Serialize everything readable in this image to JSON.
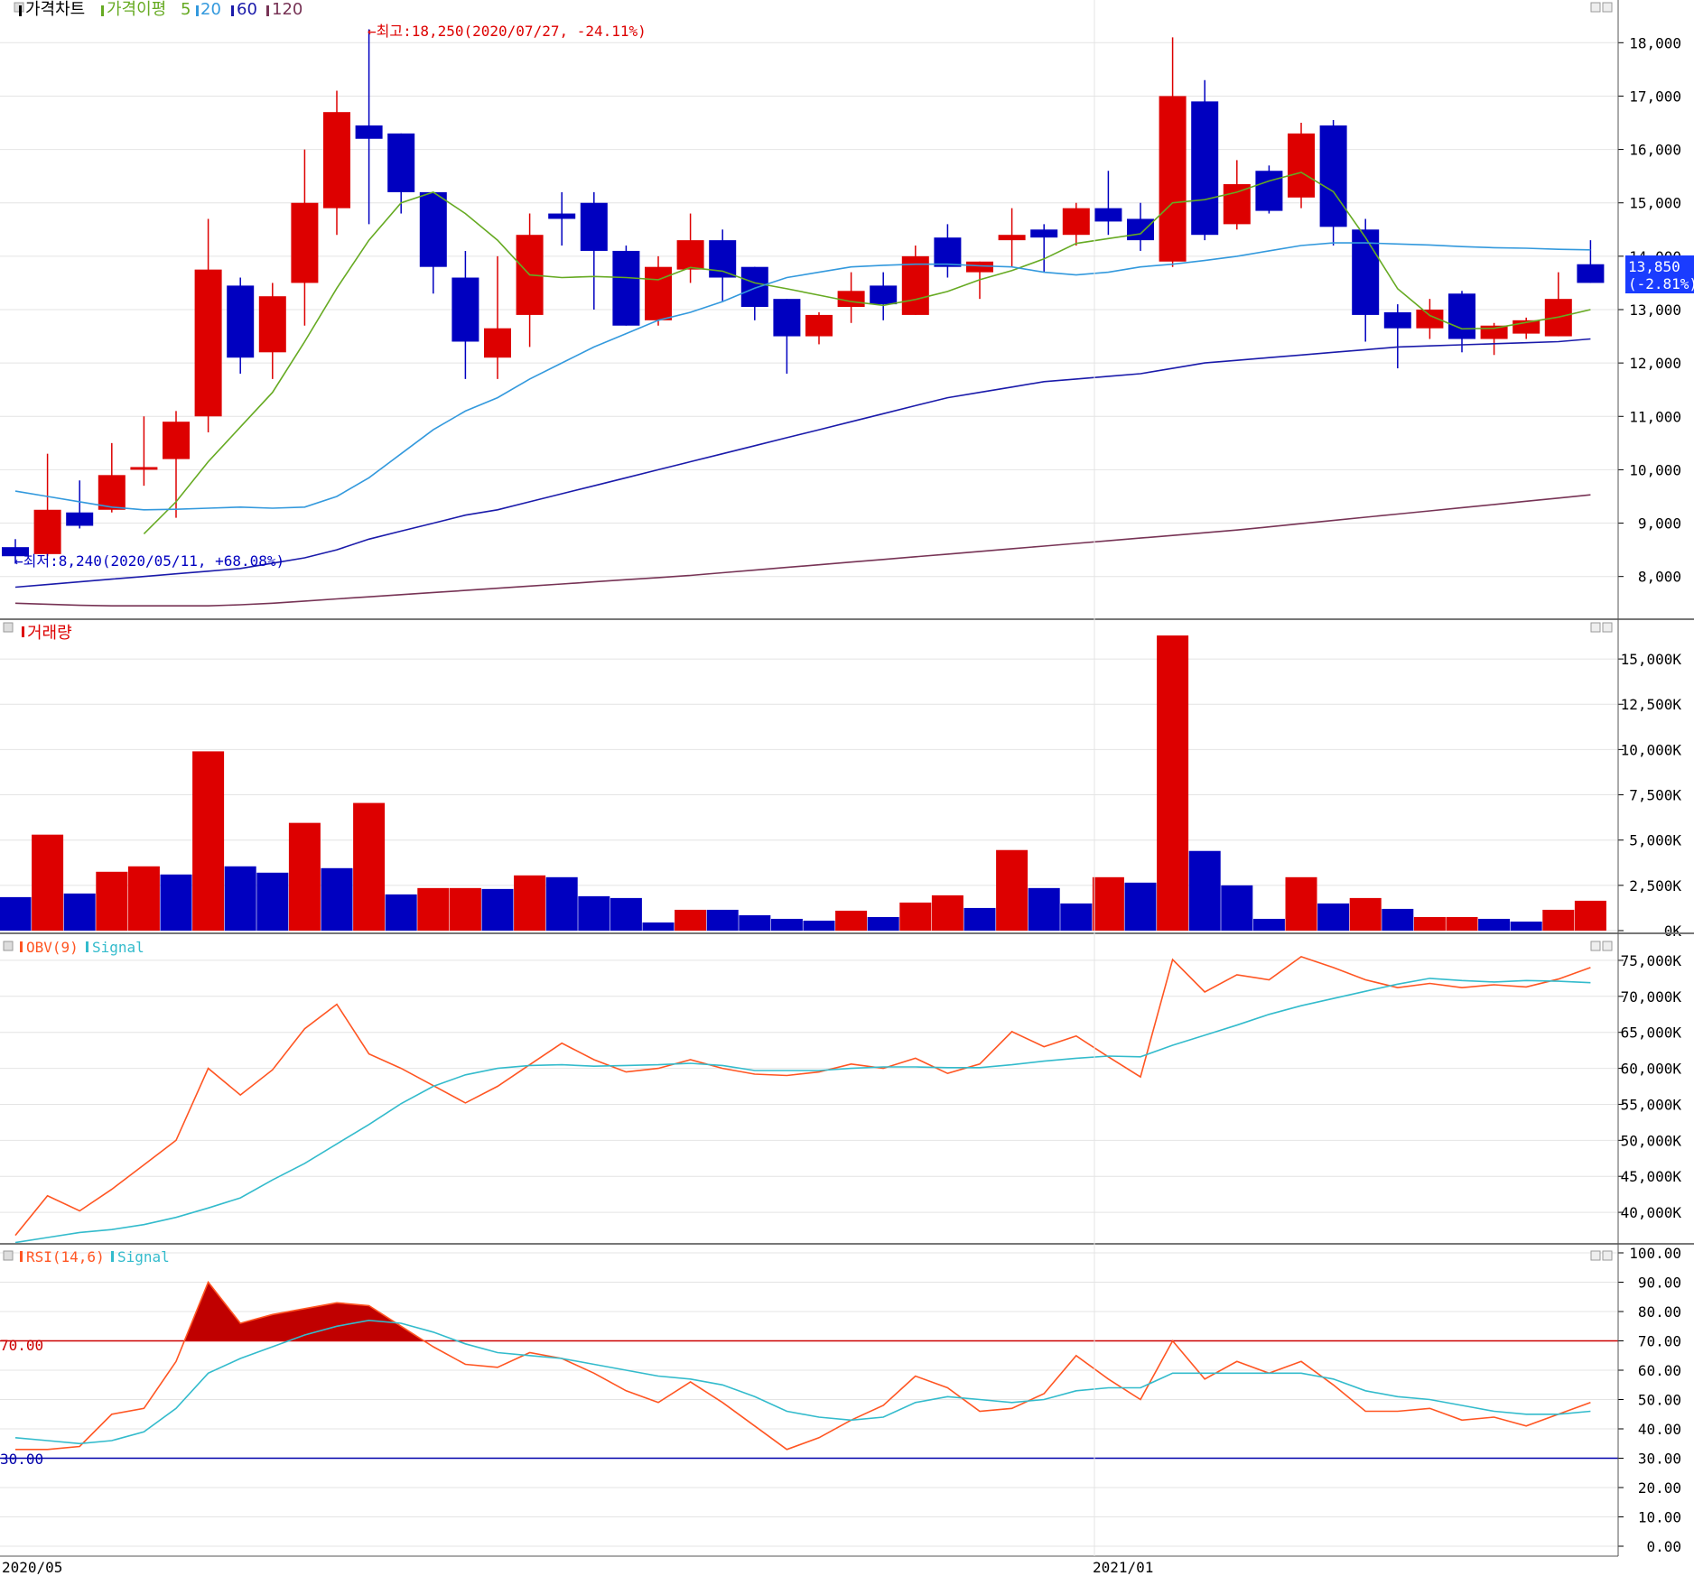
{
  "price_panel": {
    "legend_title": "가격차트",
    "legend_ma_label": "가격이평",
    "ma_periods": [
      "5",
      "20",
      "60",
      "120"
    ],
    "high_marker": "←최고:18,250(2020/07/27, -24.11%)",
    "low_marker": "←최저:8,240(2020/05/11, +68.08%)",
    "current_price": "13,850",
    "current_change": "(-2.81%)",
    "y_ticks": [
      "8,000",
      "9,000",
      "10,000",
      "11,000",
      "12,000",
      "13,000",
      "14,000",
      "15,000",
      "16,000",
      "17,000",
      "18,000"
    ]
  },
  "volume_panel": {
    "legend_title": "거래량",
    "y_ticks": [
      "0K",
      "2,500K",
      "5,000K",
      "7,500K",
      "10,000K",
      "12,500K",
      "15,000K"
    ]
  },
  "obv_panel": {
    "legend_title": "OBV(9)",
    "legend_signal": "Signal",
    "y_ticks": [
      "40,000K",
      "45,000K",
      "50,000K",
      "55,000K",
      "60,000K",
      "65,000K",
      "70,000K",
      "75,000K"
    ]
  },
  "rsi_panel": {
    "legend_title": "RSI(14,6)",
    "legend_signal": "Signal",
    "upper_line_label": "70.00",
    "lower_line_label": "30.00",
    "y_ticks": [
      "0.00",
      "10.00",
      "20.00",
      "30.00",
      "40.00",
      "50.00",
      "60.00",
      "70.00",
      "80.00",
      "90.00",
      "100.00"
    ]
  },
  "x_axis": {
    "labels": [
      "2020/05",
      "2021/01"
    ]
  },
  "colors": {
    "up": "#dd0000",
    "down": "#0000c0",
    "ma5": "#66aa22",
    "ma20": "#3399dd",
    "ma60": "#1a1aaa",
    "ma120": "#773355",
    "obv": "#ff5522",
    "signal": "#33bbcc",
    "rsi_fill": "#c00000",
    "upper": "#cc0000",
    "lower": "#0000aa"
  },
  "chart_data": [
    {
      "type": "candlestick",
      "title": "가격차트",
      "interval": "weekly",
      "x_start": "2020/05",
      "ylim": [
        7200,
        18800
      ],
      "candles": [
        [
          8550,
          8700,
          8240,
          8380
        ],
        [
          8420,
          10300,
          8380,
          9250
        ],
        [
          9200,
          9800,
          8900,
          8950
        ],
        [
          9250,
          10500,
          9200,
          9900
        ],
        [
          10000,
          11000,
          9700,
          10050
        ],
        [
          10200,
          11100,
          9100,
          10900
        ],
        [
          11000,
          14700,
          10700,
          13750
        ],
        [
          13450,
          13600,
          11800,
          12100
        ],
        [
          12200,
          13500,
          11700,
          13250
        ],
        [
          13500,
          16000,
          12700,
          15000
        ],
        [
          14900,
          17100,
          14400,
          16700
        ],
        [
          16450,
          18250,
          14600,
          16200
        ],
        [
          16300,
          16300,
          14800,
          15200
        ],
        [
          15200,
          15200,
          13300,
          13800
        ],
        [
          13600,
          14100,
          11700,
          12400
        ],
        [
          12100,
          14000,
          11700,
          12650
        ],
        [
          12900,
          14800,
          12300,
          14400
        ],
        [
          14800,
          15200,
          14200,
          14700
        ],
        [
          15000,
          15200,
          13000,
          14100
        ],
        [
          14100,
          14200,
          12700,
          12700
        ],
        [
          12800,
          14000,
          12700,
          13800
        ],
        [
          13750,
          14800,
          13500,
          14300
        ],
        [
          14300,
          14500,
          13150,
          13600
        ],
        [
          13800,
          13800,
          12800,
          13050
        ],
        [
          13200,
          13200,
          11800,
          12500
        ],
        [
          12500,
          12950,
          12350,
          12900
        ],
        [
          13050,
          13700,
          12750,
          13350
        ],
        [
          13450,
          13700,
          12800,
          13100
        ],
        [
          12900,
          14200,
          12900,
          14000
        ],
        [
          14350,
          14600,
          13600,
          13800
        ],
        [
          13700,
          13900,
          13200,
          13900
        ],
        [
          14300,
          14900,
          13800,
          14400
        ],
        [
          14500,
          14600,
          13700,
          14350
        ],
        [
          14400,
          15000,
          14200,
          14900
        ],
        [
          14900,
          15600,
          14400,
          14650
        ],
        [
          14700,
          15000,
          14100,
          14300
        ],
        [
          13900,
          18100,
          13800,
          17000
        ],
        [
          16900,
          17300,
          14300,
          14400
        ],
        [
          14600,
          15800,
          14500,
          15350
        ],
        [
          15600,
          15700,
          14800,
          14850
        ],
        [
          15100,
          16500,
          14900,
          16300
        ],
        [
          16450,
          16550,
          14200,
          14550
        ],
        [
          14500,
          14700,
          12400,
          12900
        ],
        [
          12950,
          13100,
          11900,
          12650
        ],
        [
          12650,
          13200,
          12450,
          13000
        ],
        [
          13300,
          13350,
          12200,
          12450
        ],
        [
          12450,
          12750,
          12150,
          12700
        ],
        [
          12550,
          12850,
          12450,
          12800
        ],
        [
          12500,
          13700,
          12500,
          13200
        ],
        [
          13850,
          14300,
          13500,
          13500
        ]
      ],
      "series": [
        {
          "name": "5",
          "values": [
            null,
            null,
            null,
            null,
            8800,
            9400,
            10150,
            10800,
            11450,
            12400,
            13400,
            14300,
            15000,
            15200,
            14800,
            14300,
            13650,
            13600,
            13620,
            13600,
            13560,
            13790,
            13720,
            13500,
            13390,
            13270,
            13150,
            13080,
            13190,
            13340,
            13560,
            13730,
            13950,
            14240,
            14330,
            14420,
            15000,
            15060,
            15200,
            15410,
            15570,
            15210,
            14350,
            13390,
            12890,
            12640,
            12650,
            12760,
            12860,
            13000
          ]
        },
        {
          "name": "20",
          "values": [
            9600,
            9500,
            9400,
            9300,
            9250,
            9260,
            9280,
            9300,
            9280,
            9300,
            9500,
            9850,
            10300,
            10750,
            11100,
            11350,
            11700,
            12000,
            12300,
            12550,
            12800,
            12950,
            13150,
            13400,
            13600,
            13700,
            13800,
            13830,
            13850,
            13850,
            13820,
            13800,
            13700,
            13650,
            13700,
            13800,
            13850,
            13920,
            14000,
            14100,
            14200,
            14250,
            14250,
            14230,
            14210,
            14180,
            14160,
            14150,
            14130,
            14120
          ]
        },
        {
          "name": "60",
          "values": [
            7800,
            7850,
            7900,
            7950,
            8000,
            8050,
            8100,
            8150,
            8250,
            8350,
            8500,
            8700,
            8850,
            9000,
            9150,
            9250,
            9400,
            9550,
            9700,
            9850,
            10000,
            10150,
            10300,
            10450,
            10600,
            10750,
            10900,
            11050,
            11200,
            11350,
            11450,
            11550,
            11650,
            11700,
            11750,
            11800,
            11900,
            12000,
            12050,
            12100,
            12150,
            12200,
            12250,
            12300,
            12320,
            12340,
            12360,
            12380,
            12400,
            12450
          ]
        },
        {
          "name": "120",
          "values": [
            7500,
            7480,
            7460,
            7450,
            7450,
            7450,
            7450,
            7470,
            7500,
            7540,
            7580,
            7620,
            7660,
            7700,
            7740,
            7780,
            7820,
            7860,
            7900,
            7940,
            7980,
            8020,
            8070,
            8120,
            8170,
            8220,
            8270,
            8320,
            8370,
            8420,
            8470,
            8520,
            8570,
            8620,
            8670,
            8720,
            8770,
            8820,
            8870,
            8930,
            8990,
            9050,
            9110,
            9170,
            9230,
            9290,
            9350,
            9410,
            9470,
            9530
          ]
        }
      ]
    },
    {
      "type": "bar",
      "title": "거래량",
      "ylim": [
        0,
        16500
      ],
      "unit": "K",
      "values": [
        1850,
        5300,
        2050,
        3250,
        3550,
        3100,
        9900,
        3550,
        3200,
        5950,
        3450,
        7050,
        2000,
        2350,
        2350,
        2300,
        3050,
        2950,
        1900,
        1800,
        450,
        1150,
        1150,
        850,
        650,
        550,
        1100,
        750,
        1550,
        1950,
        1250,
        4450,
        2350,
        1500,
        2950,
        2650,
        16300,
        4400,
        2500,
        650,
        2950,
        1500,
        1800,
        1200,
        750,
        750,
        650,
        500,
        1150,
        1650
      ],
      "colors": [
        "down",
        "up",
        "down",
        "up",
        "up",
        "down",
        "up",
        "down",
        "down",
        "up",
        "down",
        "up",
        "down",
        "up",
        "up",
        "down",
        "up",
        "down",
        "down",
        "down",
        "down",
        "up",
        "down",
        "down",
        "down",
        "down",
        "up",
        "down",
        "up",
        "up",
        "down",
        "up",
        "down",
        "down",
        "up",
        "down",
        "up",
        "down",
        "down",
        "down",
        "up",
        "down",
        "up",
        "down",
        "up",
        "up",
        "down",
        "down",
        "up",
        "up"
      ]
    },
    {
      "type": "line",
      "title": "OBV(9)",
      "ylim": [
        36000,
        78000
      ],
      "unit": "K",
      "series": [
        {
          "name": "OBV(9)",
          "values": [
            36800,
            42300,
            40200,
            43200,
            46600,
            50000,
            60000,
            56300,
            59800,
            65500,
            68900,
            62000,
            60000,
            57600,
            55200,
            57500,
            60500,
            63500,
            61200,
            59500,
            60000,
            61200,
            60000,
            59200,
            59000,
            59500,
            60600,
            60000,
            61400,
            59300,
            60600,
            65100,
            63000,
            64500,
            61600,
            58800,
            75100,
            70600,
            73000,
            72300,
            75500,
            74000,
            72300,
            71200,
            71800,
            71200,
            71600,
            71300,
            72400,
            74000
          ]
        },
        {
          "name": "Signal",
          "values": [
            35800,
            36500,
            37200,
            37600,
            38300,
            39300,
            40600,
            42000,
            44500,
            46800,
            49500,
            52200,
            55100,
            57500,
            59100,
            60000,
            60400,
            60500,
            60300,
            60400,
            60500,
            60700,
            60400,
            59700,
            59700,
            59700,
            60000,
            60200,
            60200,
            60100,
            60100,
            60500,
            61000,
            61400,
            61700,
            61600,
            63200,
            64600,
            66000,
            67500,
            68700,
            69700,
            70700,
            71700,
            72500,
            72200,
            72000,
            72200,
            72100,
            71900
          ]
        }
      ]
    },
    {
      "type": "area",
      "title": "RSI(14,6)",
      "ylim": [
        0,
        100
      ],
      "reference_lines": [
        70,
        30
      ],
      "series": [
        {
          "name": "RSI(14,6)",
          "values": [
            33,
            33,
            34,
            45,
            47,
            63,
            90,
            76,
            79,
            81,
            83,
            82,
            75,
            68,
            62,
            61,
            66,
            64,
            59,
            53,
            49,
            56,
            49,
            41,
            33,
            37,
            43,
            48,
            58,
            54,
            46,
            47,
            52,
            65,
            57,
            50,
            70,
            57,
            63,
            59,
            63,
            55,
            46,
            46,
            47,
            43,
            44,
            41,
            45,
            49
          ]
        },
        {
          "name": "Signal",
          "values": [
            37,
            36,
            35,
            36,
            39,
            47,
            59,
            64,
            68,
            72,
            75,
            77,
            76,
            73,
            69,
            66,
            65,
            64,
            62,
            60,
            58,
            57,
            55,
            51,
            46,
            44,
            43,
            44,
            49,
            51,
            50,
            49,
            50,
            53,
            54,
            54,
            59,
            59,
            59,
            59,
            59,
            57,
            53,
            51,
            50,
            48,
            46,
            45,
            45,
            46
          ]
        }
      ]
    }
  ]
}
